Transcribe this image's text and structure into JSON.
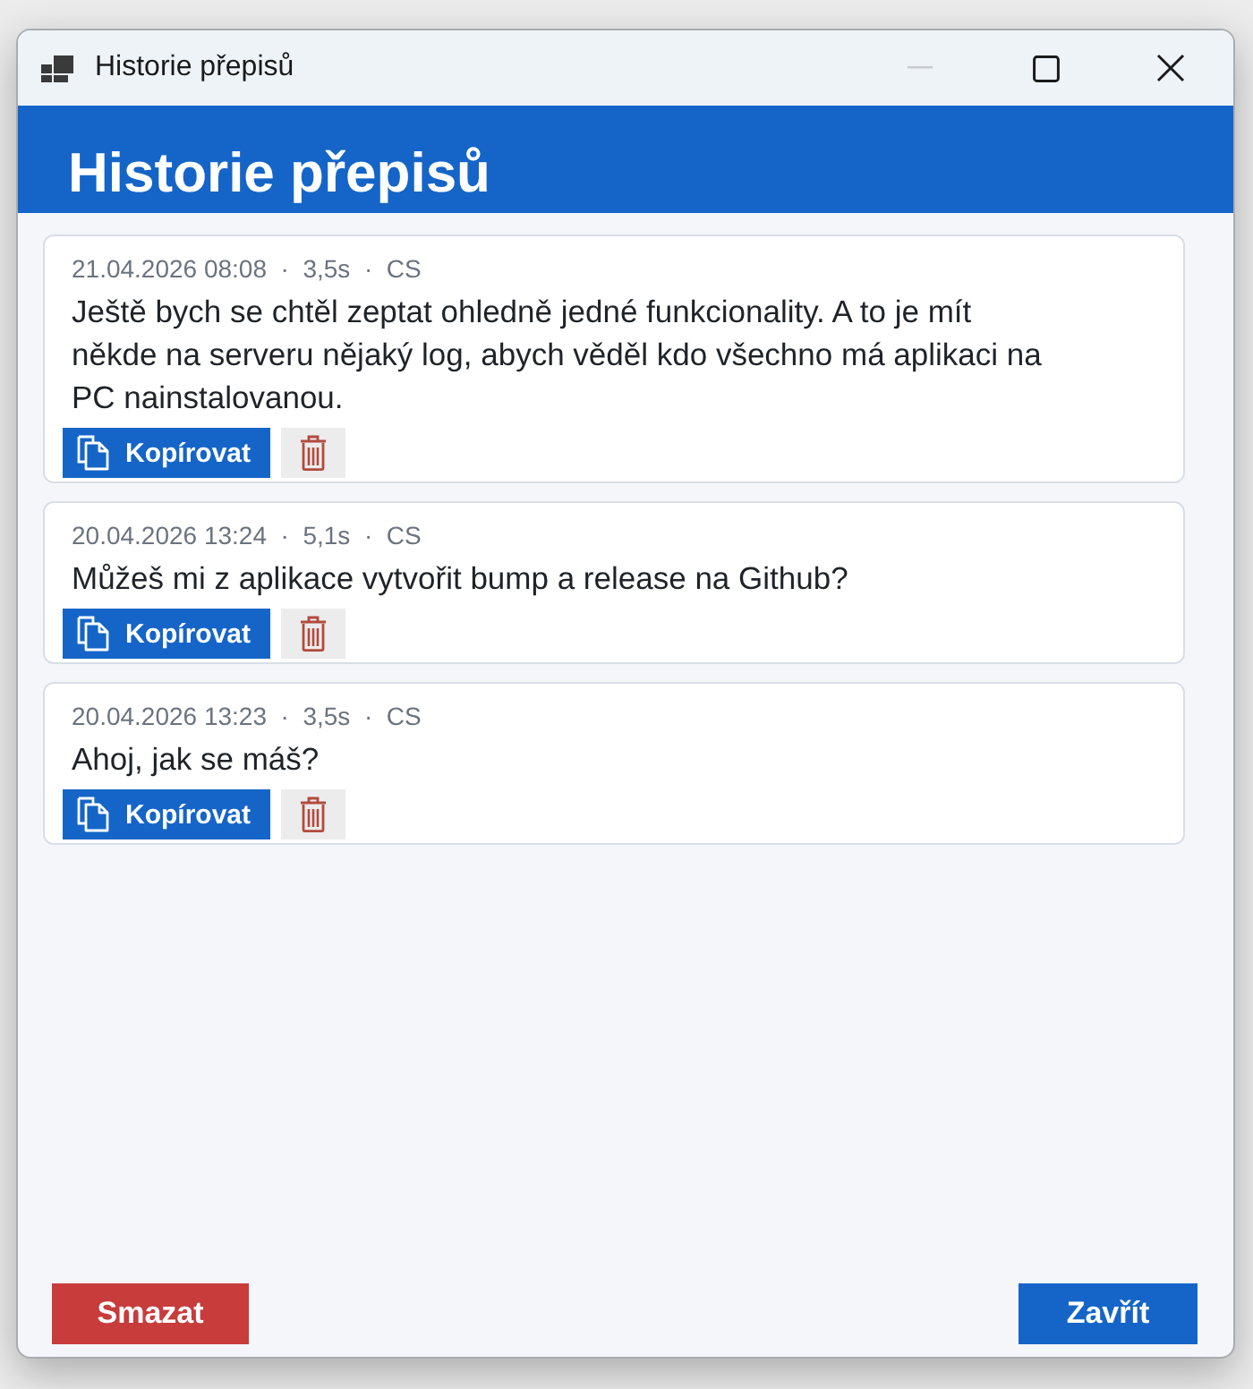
{
  "window": {
    "title": "Historie přepisů",
    "minimize_disabled": true
  },
  "header": {
    "title": "Historie přepisů"
  },
  "entries": [
    {
      "meta": "21.04.2026 08:08  ·  3,5s  ·  CS",
      "text": "Ještě bych se chtěl zeptat ohledně jedné funkcionality. A to je mít někde na serveru nějaký log, abych věděl kdo všechno má aplikaci na PC nainstalovanou.",
      "copy_label": "Kopírovat"
    },
    {
      "meta": "20.04.2026 13:24  ·  5,1s  ·  CS",
      "text": "Můžeš mi z aplikace vytvořit bump a release na Github?",
      "copy_label": "Kopírovat"
    },
    {
      "meta": "20.04.2026 13:23  ·  3,5s  ·  CS",
      "text": "Ahoj, jak se máš?",
      "copy_label": "Kopírovat"
    }
  ],
  "footer": {
    "buttons": [
      {
        "label": "Smazat",
        "kind": "danger"
      },
      {
        "label": "Zavřít",
        "kind": "primary"
      }
    ]
  }
}
